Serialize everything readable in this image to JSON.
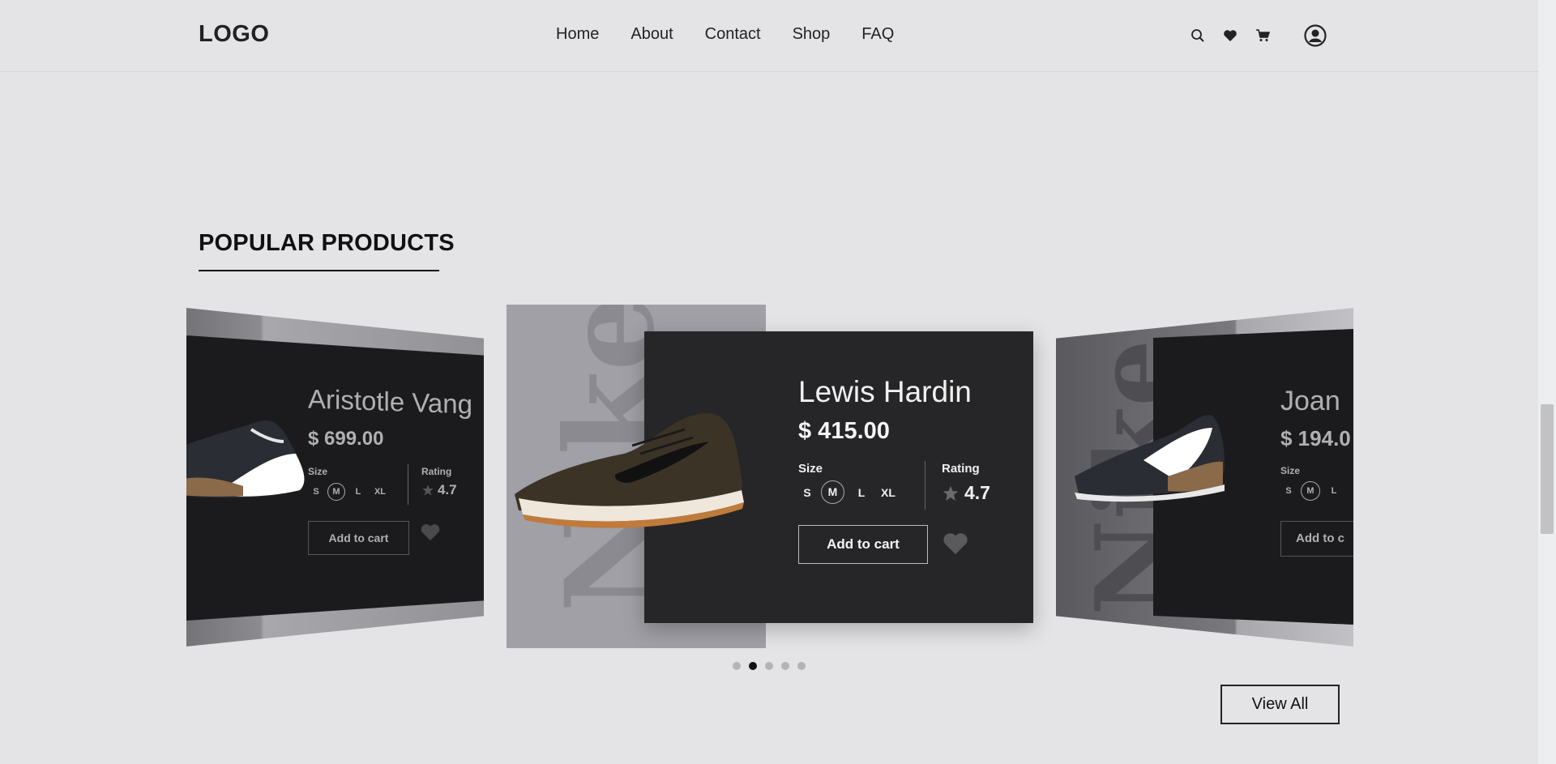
{
  "header": {
    "logo": "LOGO",
    "nav": [
      "Home",
      "About",
      "Contact",
      "Shop",
      "FAQ"
    ],
    "icons": [
      "search-icon",
      "heart-icon",
      "cart-icon",
      "profile-icon"
    ]
  },
  "section": {
    "title": "POPULAR PRODUCTS"
  },
  "carousel": {
    "brand_watermark": "Nike",
    "products": [
      {
        "name": "Aristotle Vang",
        "price": "$ 699.00",
        "size_label": "Size",
        "sizes": [
          "S",
          "M",
          "L",
          "XL"
        ],
        "selected_size": "M",
        "rating_label": "Rating",
        "rating": "4.7",
        "cart_label": "Add to cart"
      },
      {
        "name": "Lewis Hardin",
        "price": "$ 415.00",
        "size_label": "Size",
        "sizes": [
          "S",
          "M",
          "L",
          "XL"
        ],
        "selected_size": "M",
        "rating_label": "Rating",
        "rating": "4.7",
        "cart_label": "Add to cart"
      },
      {
        "name": "Joan",
        "price": "$ 194.0",
        "size_label": "Size",
        "sizes": [
          "S",
          "M",
          "L"
        ],
        "selected_size": "M",
        "cart_label": "Add to c"
      }
    ],
    "dots": 5,
    "active_dot": 2
  },
  "view_all": "View All",
  "colors": {
    "background": "#e4e4e6",
    "card_dark": "#262628",
    "accent": "#111111"
  }
}
